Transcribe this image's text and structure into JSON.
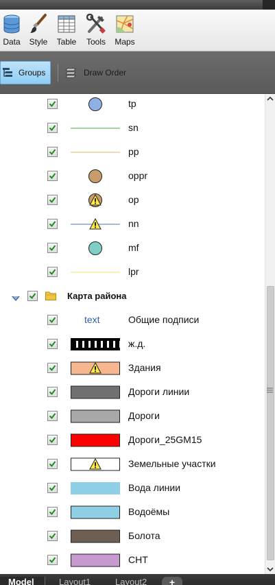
{
  "ribbon": {
    "buttons": [
      {
        "label": "Data",
        "icon": "database-icon"
      },
      {
        "label": "Style",
        "icon": "paintbrush-icon"
      },
      {
        "label": "Table",
        "icon": "table-icon"
      },
      {
        "label": "Tools",
        "icon": "tools-icon"
      },
      {
        "label": "Maps",
        "icon": "maps-icon"
      }
    ]
  },
  "toolbar": {
    "groups_label": "Groups",
    "draw_order_label": "Draw Order"
  },
  "layers": [
    {
      "label": "tp",
      "checked": true,
      "symbol": "circle",
      "fill": "#8fb0e6"
    },
    {
      "label": "sn",
      "checked": true,
      "symbol": "line",
      "stroke": "#6fb86f"
    },
    {
      "label": "pp",
      "checked": true,
      "symbol": "line",
      "stroke": "#e3c77e"
    },
    {
      "label": "oppr",
      "checked": true,
      "symbol": "circle",
      "fill": "#c99c6b"
    },
    {
      "label": "op",
      "checked": true,
      "symbol": "circle-warning",
      "fill": "#c99c6b"
    },
    {
      "label": "nn",
      "checked": true,
      "symbol": "line-warning",
      "stroke": "#6f94c2"
    },
    {
      "label": "mf",
      "checked": true,
      "symbol": "circle",
      "fill": "#7fcfc6"
    },
    {
      "label": "lpr",
      "checked": true,
      "symbol": "line",
      "stroke": "#f0e68a"
    }
  ],
  "group": {
    "label": "Карта района",
    "checked": true,
    "expanded": true
  },
  "group_layers": [
    {
      "label": "Общие подписи",
      "checked": true,
      "symbol": "text",
      "sample": "text",
      "color": "#2f5fa8"
    },
    {
      "label": "ж.д.",
      "checked": true,
      "symbol": "rail"
    },
    {
      "label": "Здания",
      "checked": true,
      "symbol": "rect-warning",
      "fill": "#f6b78f"
    },
    {
      "label": "Дороги линии",
      "checked": true,
      "symbol": "rect",
      "fill": "#707070"
    },
    {
      "label": "Дороги",
      "checked": true,
      "symbol": "rect",
      "fill": "#a8a8a8"
    },
    {
      "label": "Дороги_25GM15",
      "checked": true,
      "symbol": "rect",
      "fill": "#ff0000"
    },
    {
      "label": "Земельные участки",
      "checked": true,
      "symbol": "rect-warning",
      "fill": "#ffffff"
    },
    {
      "label": "Вода линии",
      "checked": true,
      "symbol": "rect-noborder",
      "fill": "#8fcfe6"
    },
    {
      "label": "Водоёмы",
      "checked": true,
      "symbol": "rect",
      "fill": "#8fcfe6"
    },
    {
      "label": "Болота",
      "checked": true,
      "symbol": "rect",
      "fill": "#6e5f52"
    },
    {
      "label": "СНТ",
      "checked": true,
      "symbol": "rect",
      "fill": "#c79bd0"
    }
  ],
  "tabs": [
    {
      "label": "Model",
      "active": true
    },
    {
      "label": "Layout1",
      "active": false
    },
    {
      "label": "Layout2",
      "active": false
    }
  ],
  "add_tab_label": "+"
}
